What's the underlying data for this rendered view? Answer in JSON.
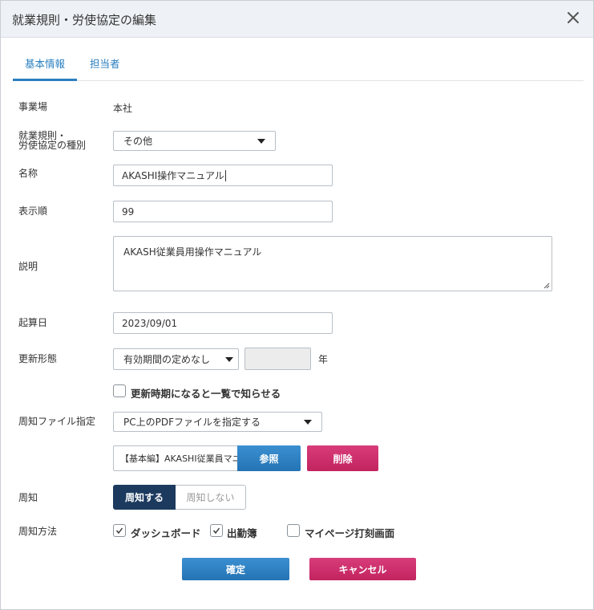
{
  "dialog": {
    "title": "就業規則・労使協定の編集",
    "close_icon": "close-icon"
  },
  "tabs": [
    {
      "label": "基本情報",
      "active": true
    },
    {
      "label": "担当者",
      "active": false
    }
  ],
  "form": {
    "office": {
      "label": "事業場",
      "value": "本社"
    },
    "type": {
      "label_line1": "就業規則・",
      "label_line2": "労使協定の種別",
      "value": "その他"
    },
    "name": {
      "label": "名称",
      "value": "AKASHI操作マニュアル"
    },
    "order": {
      "label": "表示順",
      "value": "99"
    },
    "description": {
      "label": "説明",
      "value": "AKASH従業員用操作マニュアル"
    },
    "start_date": {
      "label": "起算日",
      "value": "2023/09/01"
    },
    "renewal": {
      "label": "更新形態",
      "value": "有効期間の定めなし",
      "years_value": "",
      "years_unit": "年",
      "notify_label": "更新時期になると一覧で知らせる",
      "notify_checked": false
    },
    "notice_file": {
      "label": "周知ファイル指定",
      "value": "PC上のPDFファイルを指定する",
      "file_name": "【基本編】AKASHI従業員マニ",
      "browse_label": "参照",
      "delete_label": "削除"
    },
    "notice": {
      "label": "周知",
      "on_label": "周知する",
      "off_label": "周知しない",
      "selected": "on"
    },
    "notice_method": {
      "label": "周知方法",
      "options": [
        {
          "label": "ダッシュボード",
          "checked": true
        },
        {
          "label": "出勤簿",
          "checked": true
        },
        {
          "label": "マイページ打刻画面",
          "checked": false
        }
      ]
    }
  },
  "footer": {
    "confirm_label": "確定",
    "cancel_label": "キャンセル"
  },
  "colors": {
    "primary": "#2a7fc0",
    "danger": "#c2245f",
    "toggle_active": "#1c3a5e"
  }
}
